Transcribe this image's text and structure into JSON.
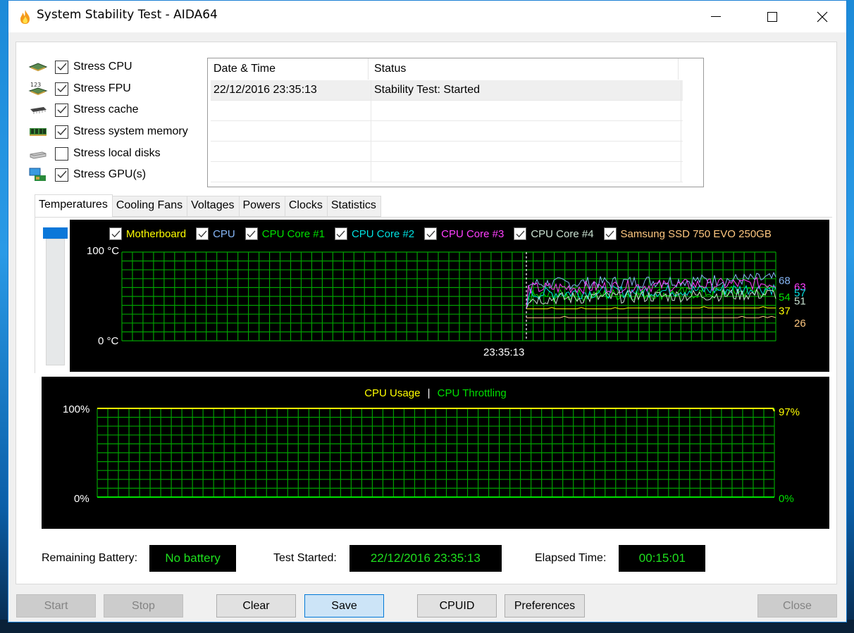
{
  "window": {
    "title": "System Stability Test - AIDA64",
    "app_icon": "flame-icon",
    "controls": [
      "minimize",
      "maximize",
      "close"
    ]
  },
  "stress_options": [
    {
      "label": "Stress CPU",
      "checked": true,
      "icon": "cpu-chip-icon"
    },
    {
      "label": "Stress FPU",
      "checked": true,
      "icon": "fpu-chip-icon"
    },
    {
      "label": "Stress cache",
      "checked": true,
      "icon": "cache-chip-icon"
    },
    {
      "label": "Stress system memory",
      "checked": true,
      "icon": "memory-module-icon"
    },
    {
      "label": "Stress local disks",
      "checked": false,
      "icon": "disk-drive-icon"
    },
    {
      "label": "Stress GPU(s)",
      "checked": true,
      "icon": "gpu-icon"
    }
  ],
  "log": {
    "columns": [
      "Date & Time",
      "Status"
    ],
    "rows": [
      {
        "datetime": "22/12/2016 23:35:13",
        "status": "Stability Test: Started"
      }
    ]
  },
  "tabs": [
    {
      "label": "Temperatures",
      "active": true
    },
    {
      "label": "Cooling Fans",
      "active": false
    },
    {
      "label": "Voltages",
      "active": false
    },
    {
      "label": "Powers",
      "active": false
    },
    {
      "label": "Clocks",
      "active": false
    },
    {
      "label": "Statistics",
      "active": false
    }
  ],
  "temperature_graph": {
    "y_max_label": "100",
    "y_min_label": "0",
    "unit": "°C",
    "start_marker_label": "23:35:13",
    "grid_color": "#00a000",
    "sensors": [
      {
        "label": "Motherboard",
        "checked": true,
        "color": "#ffff00",
        "current": 37
      },
      {
        "label": "CPU",
        "checked": true,
        "color": "#86b6f6",
        "current": 68
      },
      {
        "label": "CPU Core #1",
        "checked": true,
        "color": "#00e000",
        "current": 54
      },
      {
        "label": "CPU Core #2",
        "checked": true,
        "color": "#00e0e0",
        "current": 57
      },
      {
        "label": "CPU Core #3",
        "checked": true,
        "color": "#ff40ff",
        "current": 63
      },
      {
        "label": "CPU Core #4",
        "checked": true,
        "color": "#c8e0d0",
        "current": 51
      },
      {
        "label": "Samsung SSD 750 EVO 250GB",
        "checked": true,
        "color": "#ffc880",
        "current": 26
      }
    ]
  },
  "cpu_graph": {
    "legend_usage": "CPU Usage",
    "legend_separator": "|",
    "legend_throttling": "CPU Throttling",
    "usage_color": "#ffff00",
    "throttling_color": "#00e000",
    "y_max_label": "100%",
    "y_min_label": "0%",
    "usage_current": "97%",
    "throttling_current": "0%"
  },
  "status": {
    "battery_label": "Remaining Battery:",
    "battery_value": "No battery",
    "started_label": "Test Started:",
    "started_value": "22/12/2016 23:35:13",
    "elapsed_label": "Elapsed Time:",
    "elapsed_value": "00:15:01"
  },
  "buttons": {
    "start": "Start",
    "stop": "Stop",
    "clear": "Clear",
    "save": "Save",
    "cpuid": "CPUID",
    "preferences": "Preferences",
    "close": "Close"
  }
}
